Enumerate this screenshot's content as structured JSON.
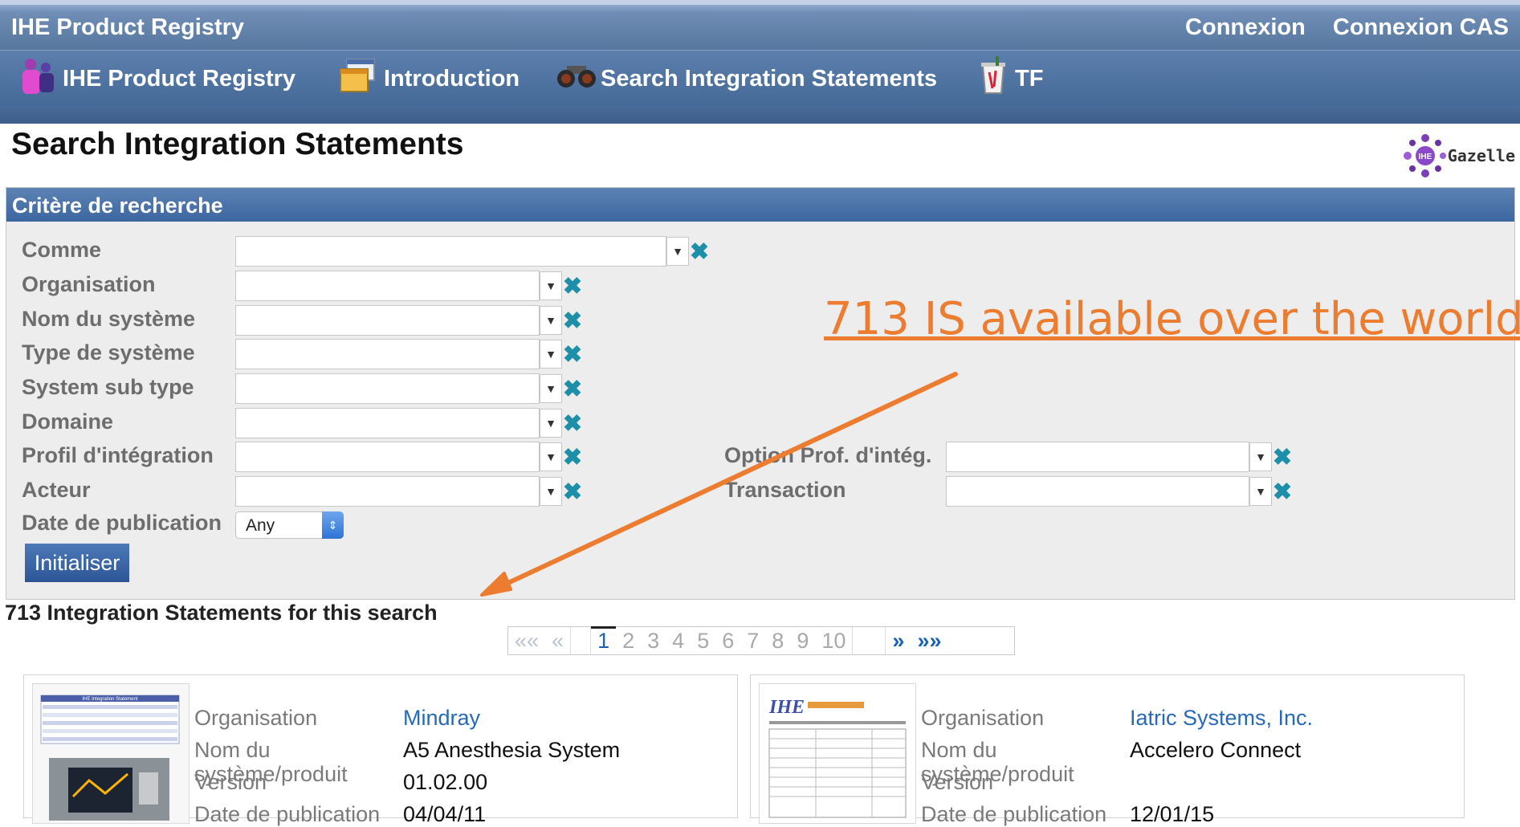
{
  "header": {
    "app_title": "IHE Product Registry",
    "links": [
      "Connexion",
      "Connexion CAS"
    ]
  },
  "nav": {
    "items": [
      {
        "label": "IHE Product Registry",
        "icon": "users-icon"
      },
      {
        "label": "Introduction",
        "icon": "windows-icon"
      },
      {
        "label": "Search Integration Statements",
        "icon": "binoculars-icon"
      },
      {
        "label": "TF",
        "icon": "trash-icon"
      }
    ]
  },
  "page": {
    "title": "Search Integration Statements",
    "logo_text": "Gazelle",
    "logo_badge": "IHE"
  },
  "criteria": {
    "header": "Critère de recherche",
    "fields": {
      "comme": "Comme",
      "organisation": "Organisation",
      "nom_systeme": "Nom du système",
      "type_systeme": "Type de système",
      "sub_type": "System sub type",
      "domaine": "Domaine",
      "profil": "Profil d'intégration",
      "acteur": "Acteur",
      "date_pub": "Date de publication",
      "option_profil": "Option Prof. d'intég.",
      "transaction": "Transaction"
    },
    "date_value": "Any",
    "reset_label": "Initialiser"
  },
  "results": {
    "count_text": "713 Integration Statements for this search",
    "pager": {
      "first": "««",
      "prev": "«",
      "pages": [
        "1",
        "2",
        "3",
        "4",
        "5",
        "6",
        "7",
        "8",
        "9",
        "10"
      ],
      "current": "1",
      "next": "»",
      "last": "»»"
    },
    "cards": [
      {
        "org_label": "Organisation",
        "org_value": "Mindray",
        "name_label_1": "Nom du",
        "name_label_2": "système/produit",
        "name_value": "A5 Anesthesia System",
        "version_label": "Version",
        "version_value": "01.02.00",
        "date_label": "Date de publication",
        "date_value": "04/04/11",
        "thumb_title": "IHE Integration Statement"
      },
      {
        "org_label": "Organisation",
        "org_value": "Iatric Systems, Inc.",
        "name_label_1": "Nom du",
        "name_label_2": "système/produit",
        "name_value": "Accelero Connect",
        "version_label": "Version",
        "version_value": "",
        "date_label": "Date de publication",
        "date_value": "12/01/15",
        "thumb_title": "IHE"
      }
    ]
  },
  "annotation": {
    "text": "713 IS available over the world",
    "color": "#ec7c30"
  }
}
